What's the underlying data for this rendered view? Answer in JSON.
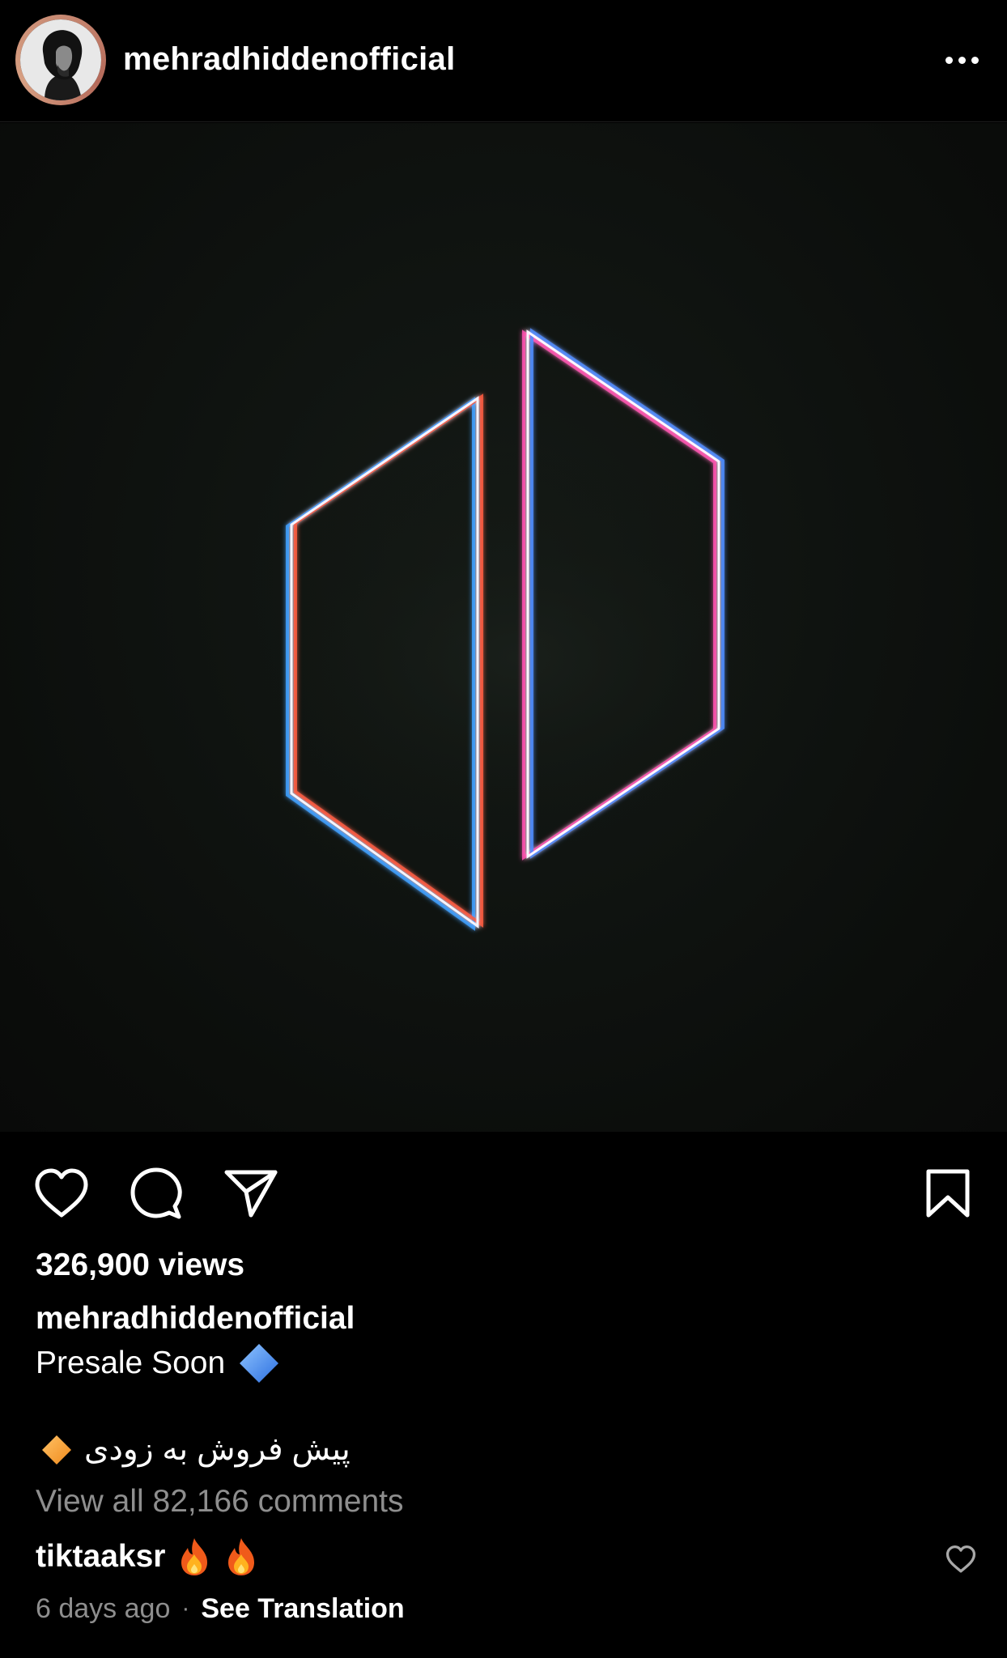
{
  "header": {
    "username": "mehradhiddenofficial"
  },
  "actions": {
    "icons": [
      "heart-icon",
      "comment-icon",
      "send-icon",
      "bookmark-icon"
    ]
  },
  "post": {
    "views": "326,900 views",
    "caption_username": "mehradhiddenofficial",
    "caption_line1": "Presale Soon",
    "caption_line1_emoji": "blue-diamond",
    "caption_line2": "پیش فروش به زودی",
    "caption_line2_emoji": "orange-diamond",
    "view_all_comments": "View all 82,166 comments"
  },
  "top_comment": {
    "username": "tiktaaksr",
    "emojis": [
      "fire",
      "fire"
    ],
    "time": "6 days ago",
    "separator": "·",
    "translate_label": "See Translation"
  },
  "colors": {
    "background": "#000000",
    "secondary_text": "#8e8e8e",
    "avatar_ring": "#c88a73"
  }
}
